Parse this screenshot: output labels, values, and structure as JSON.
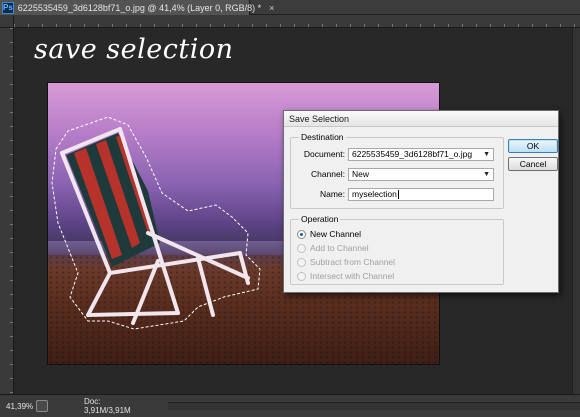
{
  "window": {
    "app_badge": "Ps",
    "doc_tab_title": "6225535459_3d6128bf71_o.jpg @ 41,4% (Layer 0, RGB/8) *",
    "tab_close": "×"
  },
  "overlay_title": "save selection",
  "status": {
    "zoom": "41,39%",
    "doc_info": "Doc: 3,91M/3,91M",
    "arrow": "▶"
  },
  "dialog": {
    "title": "Save Selection",
    "destination": {
      "group_label": "Destination",
      "document_label": "Document:",
      "document_value": "6225535459_3d6128bf71_o.jpg",
      "channel_label": "Channel:",
      "channel_value": "New",
      "name_label": "Name:",
      "name_value": "myselection"
    },
    "operation": {
      "group_label": "Operation",
      "options": [
        {
          "label": "New Channel",
          "checked": true,
          "enabled": true
        },
        {
          "label": "Add to Channel",
          "checked": false,
          "enabled": false
        },
        {
          "label": "Subtract from Channel",
          "checked": false,
          "enabled": false
        },
        {
          "label": "Intersect with Channel",
          "checked": false,
          "enabled": false
        }
      ]
    },
    "ok_label": "OK",
    "cancel_label": "Cancel"
  },
  "icons": {
    "dropdown": "chevron-down-icon",
    "ps": "photoshop-icon"
  },
  "colors": {
    "workspace": "#2b2b2b",
    "ps_blue": "#3d8ad1",
    "sky_top": "#d89ad6",
    "chair_stripe_red": "#b8322c",
    "chair_stripe_dark": "#1f3a3a"
  }
}
